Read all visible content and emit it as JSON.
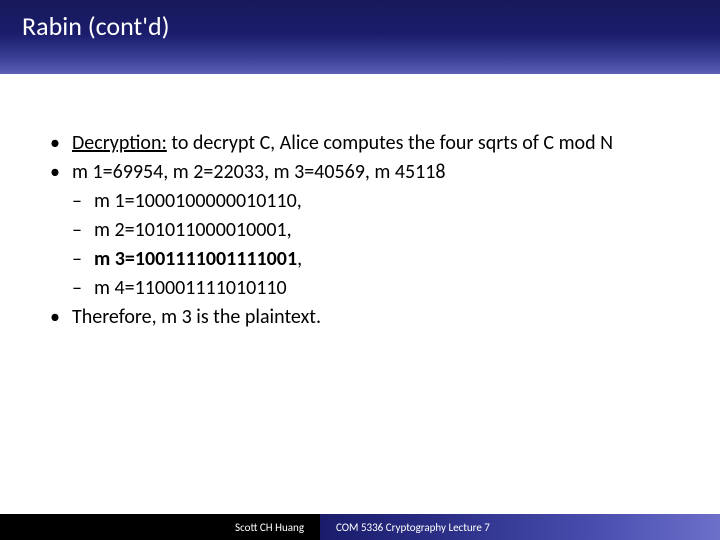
{
  "title": "Rabin (cont'd)",
  "bullets": {
    "b1_label": "Decryption:",
    "b1_rest": " to decrypt C, Alice computes the four sqrts of C mod N",
    "b2": "m 1=69954, m 2=22033, m 3=40569, m 45118",
    "d1": "m 1=1000100000010110,",
    "d2": "m 2=101011000010001,",
    "d3": "m 3=1001111001111001",
    "d3_tail": ",",
    "d4": "m 4=110001111010110",
    "b3": "Therefore, m 3 is the plaintext."
  },
  "footer": {
    "left": "Scott CH Huang",
    "right": "COM 5336 Cryptography Lecture 7"
  }
}
